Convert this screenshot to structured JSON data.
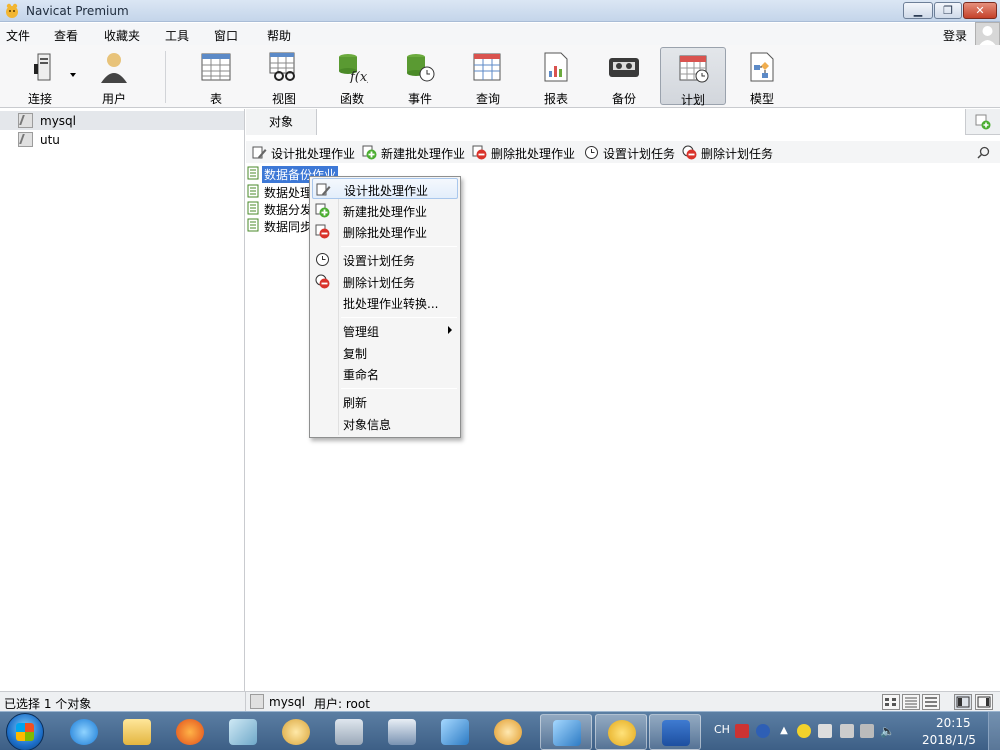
{
  "window": {
    "title": "Navicat Premium",
    "login_label": "登录"
  },
  "menubar": {
    "items": [
      "文件",
      "查看",
      "收藏夹",
      "工具",
      "窗口",
      "帮助"
    ]
  },
  "toolbar": {
    "connect_label": "连接",
    "user_label": "用户",
    "items": [
      "表",
      "视图",
      "函数",
      "事件",
      "查询",
      "报表",
      "备份",
      "计划",
      "模型"
    ],
    "active_item": "计划"
  },
  "connections": [
    {
      "name": "mysql",
      "selected": true
    },
    {
      "name": "utu",
      "selected": false
    }
  ],
  "objects_tab": {
    "label": "对象"
  },
  "object_toolbar": {
    "design_label": "设计批处理作业",
    "new_label": "新建批处理作业",
    "delete_label": "删除批处理作业",
    "set_schedule_label": "设置计划任务",
    "delete_schedule_label": "删除计划任务"
  },
  "batch_jobs": [
    {
      "name": "数据备份作业",
      "selected": true
    },
    {
      "name": "数据处理",
      "selected": false
    },
    {
      "name": "数据分发",
      "selected": false
    },
    {
      "name": "数据同步",
      "selected": false
    }
  ],
  "context_menu": {
    "design": "设计批处理作业",
    "new": "新建批处理作业",
    "delete": "删除批处理作业",
    "set_schedule": "设置计划任务",
    "delete_schedule": "删除计划任务",
    "convert": "批处理作业转换...",
    "manage_group": "管理组",
    "copy": "复制",
    "rename": "重命名",
    "refresh": "刷新",
    "object_info": "对象信息"
  },
  "statusbar": {
    "selection": "已选择 1 个对象",
    "connection": "mysql",
    "user": "用户: root"
  },
  "taskbar": {
    "lang": "CH",
    "time": "20:15",
    "date": "2018/1/5"
  },
  "colors": {
    "selection": "#3d78d6",
    "menu_highlight_border": "#a9c7ec"
  }
}
